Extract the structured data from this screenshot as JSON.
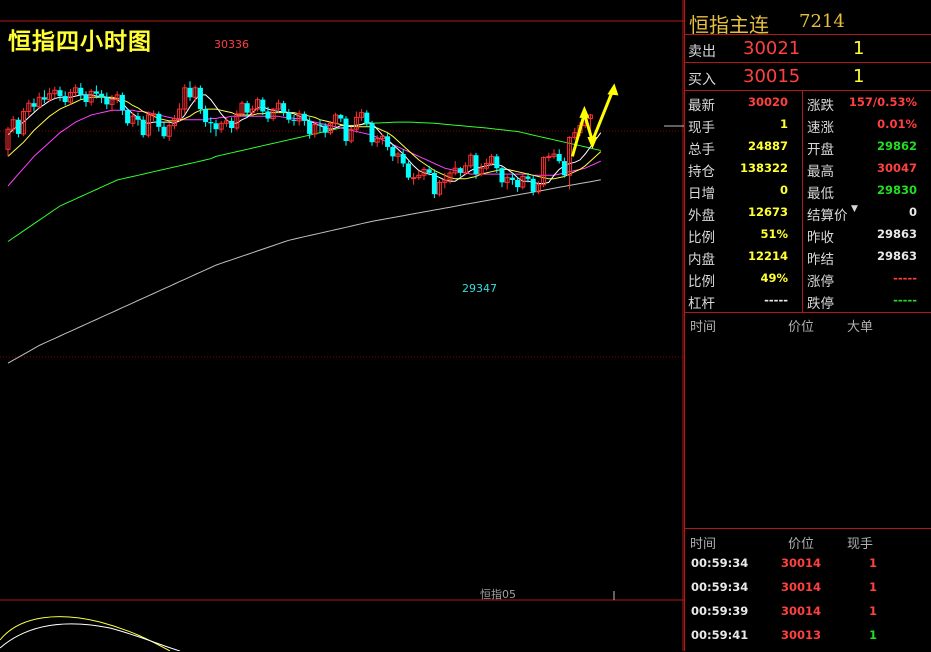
{
  "chart": {
    "title": "恒指四小时图",
    "high_label": "30336",
    "low_label": "29347",
    "contract_label": "恒指05"
  },
  "colors": {
    "up": "#ff3030",
    "down": "#00ffff",
    "ma5": "#ffffff",
    "ma10": "#ffff40",
    "ma20": "#ff40ff",
    "ma60": "#30ff30",
    "ma120": "#c0c0c0",
    "grid": "#8b0000",
    "arrow": "#ffff00"
  },
  "chart_data": {
    "type": "candlestick",
    "ylim": [
      28400,
      30600
    ],
    "candles": [
      [
        29760,
        29930,
        29700,
        29950
      ],
      [
        29930,
        30010,
        29900,
        30040
      ],
      [
        30010,
        29890,
        29860,
        30030
      ],
      [
        29890,
        30080,
        29870,
        30110
      ],
      [
        30080,
        30150,
        30040,
        30180
      ],
      [
        30150,
        30120,
        30080,
        30190
      ],
      [
        30120,
        30200,
        30100,
        30240
      ],
      [
        30200,
        30180,
        30150,
        30260
      ],
      [
        30180,
        30230,
        30160,
        30280
      ],
      [
        30230,
        30260,
        30190,
        30290
      ],
      [
        30260,
        30210,
        30170,
        30290
      ],
      [
        30210,
        30160,
        30130,
        30250
      ],
      [
        30160,
        30240,
        30140,
        30270
      ],
      [
        30240,
        30280,
        30210,
        30310
      ],
      [
        30280,
        30220,
        30180,
        30320
      ],
      [
        30220,
        30160,
        30120,
        30250
      ],
      [
        30160,
        30250,
        30130,
        30270
      ],
      [
        30250,
        30230,
        30190,
        30300
      ],
      [
        30230,
        30200,
        30150,
        30260
      ],
      [
        30200,
        30140,
        30100,
        30240
      ],
      [
        30140,
        30180,
        30080,
        30220
      ],
      [
        30180,
        30220,
        30150,
        30250
      ],
      [
        30220,
        30090,
        30050,
        30240
      ],
      [
        30090,
        29980,
        29960,
        30110
      ],
      [
        29980,
        30040,
        29950,
        30070
      ],
      [
        30040,
        30010,
        29960,
        30070
      ],
      [
        30010,
        29880,
        29860,
        30040
      ],
      [
        29880,
        30050,
        29860,
        30080
      ],
      [
        30050,
        30060,
        30000,
        30090
      ],
      [
        30060,
        29950,
        29910,
        30080
      ],
      [
        29950,
        29870,
        29850,
        29990
      ],
      [
        29870,
        29960,
        29830,
        29980
      ],
      [
        29960,
        30020,
        29930,
        30050
      ],
      [
        30020,
        30100,
        29990,
        30150
      ],
      [
        30100,
        30280,
        30060,
        30310
      ],
      [
        30280,
        30200,
        30170,
        30336
      ],
      [
        30200,
        30280,
        30160,
        30300
      ],
      [
        30280,
        30100,
        30060,
        30300
      ],
      [
        30100,
        29990,
        29950,
        30130
      ],
      [
        29990,
        29980,
        29900,
        30030
      ],
      [
        29980,
        29930,
        29870,
        30010
      ],
      [
        29930,
        29980,
        29900,
        30000
      ],
      [
        29980,
        30000,
        29950,
        30030
      ],
      [
        30000,
        29940,
        29900,
        30030
      ],
      [
        29940,
        30060,
        29920,
        30090
      ],
      [
        30060,
        30150,
        30040,
        30170
      ],
      [
        30150,
        30070,
        30030,
        30170
      ],
      [
        30070,
        30100,
        30050,
        30130
      ],
      [
        30100,
        30180,
        30080,
        30200
      ],
      [
        30180,
        30080,
        30050,
        30200
      ],
      [
        30080,
        30020,
        29990,
        30120
      ],
      [
        30020,
        30100,
        30000,
        30110
      ],
      [
        30100,
        30150,
        30070,
        30180
      ],
      [
        30150,
        30070,
        30040,
        30170
      ],
      [
        30070,
        30010,
        29980,
        30100
      ],
      [
        30010,
        30000,
        29960,
        30050
      ],
      [
        30000,
        30060,
        29960,
        30090
      ],
      [
        30060,
        30000,
        29960,
        30080
      ],
      [
        30000,
        29890,
        29850,
        30030
      ],
      [
        29890,
        29970,
        29860,
        29990
      ],
      [
        29970,
        29960,
        29900,
        30010
      ],
      [
        29960,
        29900,
        29860,
        29980
      ],
      [
        29900,
        29980,
        29880,
        30000
      ],
      [
        29980,
        30050,
        29950,
        30070
      ],
      [
        30050,
        30020,
        29990,
        30060
      ],
      [
        30020,
        29830,
        29790,
        30040
      ],
      [
        29830,
        29930,
        29810,
        29950
      ],
      [
        29930,
        30030,
        29900,
        30080
      ],
      [
        30030,
        30070,
        30000,
        30100
      ],
      [
        30070,
        29980,
        29950,
        30090
      ],
      [
        29980,
        29820,
        29790,
        30000
      ],
      [
        29820,
        29850,
        29780,
        29880
      ],
      [
        29850,
        29870,
        29800,
        29890
      ],
      [
        29870,
        29780,
        29750,
        29900
      ],
      [
        29780,
        29700,
        29660,
        29800
      ],
      [
        29700,
        29720,
        29640,
        29740
      ],
      [
        29720,
        29640,
        29610,
        29760
      ],
      [
        29640,
        29520,
        29500,
        29660
      ],
      [
        29520,
        29520,
        29460,
        29560
      ],
      [
        29520,
        29540,
        29500,
        29580
      ],
      [
        29540,
        29590,
        29500,
        29610
      ],
      [
        29590,
        29560,
        29540,
        29620
      ],
      [
        29560,
        29380,
        29347,
        29590
      ],
      [
        29380,
        29480,
        29360,
        29500
      ],
      [
        29480,
        29500,
        29430,
        29560
      ],
      [
        29500,
        29560,
        29470,
        29580
      ],
      [
        29560,
        29600,
        29540,
        29660
      ],
      [
        29600,
        29560,
        29530,
        29610
      ],
      [
        29560,
        29620,
        29540,
        29650
      ],
      [
        29620,
        29710,
        29600,
        29730
      ],
      [
        29710,
        29550,
        29510,
        29730
      ],
      [
        29550,
        29600,
        29530,
        29640
      ],
      [
        29600,
        29640,
        29580,
        29680
      ],
      [
        29640,
        29700,
        29620,
        29720
      ],
      [
        29700,
        29600,
        29560,
        29720
      ],
      [
        29600,
        29480,
        29440,
        29620
      ],
      [
        29480,
        29520,
        29420,
        29540
      ],
      [
        29520,
        29500,
        29460,
        29560
      ],
      [
        29500,
        29440,
        29400,
        29520
      ],
      [
        29440,
        29530,
        29420,
        29560
      ],
      [
        29530,
        29510,
        29480,
        29560
      ],
      [
        29510,
        29400,
        29370,
        29540
      ],
      [
        29400,
        29460,
        29380,
        29490
      ],
      [
        29460,
        29690,
        29440,
        29700
      ],
      [
        29690,
        29700,
        29660,
        29730
      ],
      [
        29700,
        29720,
        29680,
        29760
      ],
      [
        29720,
        29660,
        29640,
        29760
      ],
      [
        29660,
        29540,
        29520,
        29690
      ],
      [
        29540,
        29860,
        29420,
        29870
      ],
      [
        29860,
        29900,
        29840,
        29940
      ],
      [
        29900,
        29960,
        29870,
        29990
      ],
      [
        29960,
        30020,
        29940,
        30030
      ],
      [
        30020,
        30050,
        29870,
        30060
      ]
    ],
    "ma5": [
      29880,
      29930,
      29960,
      29990,
      30030,
      30070,
      30110,
      30140,
      30170,
      30190,
      30200,
      30200,
      30200,
      30210,
      30220,
      30220,
      30220,
      30210,
      30210,
      30200,
      30190,
      30180,
      30150,
      30100,
      30060,
      30030,
      29990,
      29980,
      29990,
      29990,
      29990,
      29990,
      29980,
      30000,
      30050,
      30120,
      30180,
      30220,
      30220,
      30180,
      30120,
      30060,
      30010,
      29980,
      29980,
      30010,
      30030,
      30070,
      30110,
      30120,
      30100,
      30090,
      30080,
      30080,
      30070,
      30060,
      30040,
      30020,
      30000,
      29980,
      29960,
      29940,
      29930,
      29940,
      29960,
      29960,
      29950,
      29960,
      29970,
      29990,
      29980,
      29930,
      29880,
      29840,
      29800,
      29760,
      29720,
      29670,
      29620,
      29580,
      29560,
      29550,
      29540,
      29520,
      29500,
      29490,
      29490,
      29520,
      29550,
      29580,
      29600,
      29610,
      29620,
      29630,
      29630,
      29620,
      29590,
      29560,
      29520,
      29490,
      29490,
      29480,
      29470,
      29470,
      29480,
      29540,
      29590,
      29620,
      29640,
      29650,
      29670,
      29720,
      29780,
      29840,
      29900
    ],
    "ma10": [
      29700,
      29740,
      29780,
      29820,
      29870,
      29920,
      29960,
      30000,
      30040,
      30070,
      30100,
      30120,
      30140,
      30160,
      30180,
      30190,
      30200,
      30200,
      30200,
      30200,
      30200,
      30190,
      30180,
      30160,
      30130,
      30110,
      30080,
      30060,
      30040,
      30020,
      30010,
      30000,
      30000,
      30000,
      30020,
      30040,
      30070,
      30090,
      30100,
      30100,
      30100,
      30090,
      30080,
      30070,
      30050,
      30050,
      30050,
      30050,
      30060,
      30060,
      30070,
      30070,
      30070,
      30070,
      30070,
      30070,
      30060,
      30050,
      30040,
      30030,
      30010,
      30000,
      29990,
      29980,
      29970,
      29960,
      29960,
      29950,
      29950,
      29950,
      29950,
      29940,
      29920,
      29900,
      29870,
      29830,
      29790,
      29750,
      29710,
      29670,
      29640,
      29610,
      29580,
      29560,
      29540,
      29520,
      29510,
      29510,
      29510,
      29520,
      29530,
      29550,
      29560,
      29570,
      29580,
      29590,
      29590,
      29580,
      29570,
      29560,
      29550,
      29540,
      29530,
      29520,
      29510,
      29510,
      29520,
      29530,
      29550,
      29570,
      29590,
      29620,
      29660,
      29700,
      29740
    ],
    "ma20": [
      29450,
      29500,
      29550,
      29600,
      29650,
      29700,
      29740,
      29780,
      29820,
      29860,
      29900,
      29930,
      29960,
      29990,
      30010,
      30030,
      30050,
      30060,
      30070,
      30080,
      30090,
      30090,
      30090,
      30090,
      30090,
      30080,
      30080,
      30070,
      30060,
      30050,
      30040,
      30030,
      30020,
      30010,
      30010,
      30010,
      30010,
      30010,
      30010,
      30020,
      30020,
      30030,
      30030,
      30040,
      30040,
      30040,
      30040,
      30040,
      30040,
      30040,
      30040,
      30040,
      30040,
      30030,
      30030,
      30020,
      30020,
      30010,
      30000,
      29990,
      29980,
      29970,
      29960,
      29950,
      29940,
      29930,
      29920,
      29910,
      29900,
      29890,
      29880,
      29860,
      29840,
      29820,
      29800,
      29780,
      29760,
      29740,
      29720,
      29700,
      29680,
      29660,
      29640,
      29620,
      29600,
      29590,
      29580,
      29570,
      29560,
      29550,
      29550,
      29550,
      29550,
      29550,
      29550,
      29550,
      29550,
      29550,
      29550,
      29550,
      29550,
      29540,
      29540,
      29540,
      29540,
      29540,
      29550,
      29560,
      29570,
      29580,
      29590,
      29600,
      29620,
      29640,
      29660
    ],
    "ma60": [
      28980,
      29010,
      29040,
      29070,
      29100,
      29130,
      29160,
      29190,
      29220,
      29250,
      29280,
      29300,
      29320,
      29340,
      29360,
      29380,
      29400,
      29420,
      29440,
      29460,
      29480,
      29500,
      29510,
      29520,
      29530,
      29540,
      29550,
      29560,
      29570,
      29580,
      29590,
      29600,
      29610,
      29620,
      29630,
      29640,
      29650,
      29660,
      29670,
      29680,
      29700,
      29710,
      29720,
      29730,
      29740,
      29750,
      29760,
      29770,
      29780,
      29790,
      29800,
      29810,
      29820,
      29830,
      29840,
      29850,
      29860,
      29870,
      29880,
      29890,
      29900,
      29910,
      29920,
      29930,
      29940,
      29950,
      29960,
      29965,
      29970,
      29975,
      29980,
      29982,
      29984,
      29986,
      29988,
      29990,
      29990,
      29990,
      29988,
      29986,
      29984,
      29982,
      29980,
      29976,
      29972,
      29968,
      29964,
      29960,
      29956,
      29952,
      29948,
      29944,
      29940,
      29935,
      29930,
      29925,
      29920,
      29915,
      29910,
      29900,
      29890,
      29880,
      29870,
      29860,
      29850,
      29840,
      29830,
      29820,
      29810,
      29800,
      29790,
      29780,
      29770,
      29760,
      29750
    ],
    "ma120": [
      27950,
      27975,
      28000,
      28025,
      28050,
      28075,
      28100,
      28120,
      28140,
      28160,
      28180,
      28200,
      28220,
      28240,
      28260,
      28280,
      28300,
      28320,
      28340,
      28360,
      28380,
      28400,
      28420,
      28440,
      28460,
      28480,
      28500,
      28520,
      28540,
      28560,
      28580,
      28600,
      28620,
      28640,
      28660,
      28680,
      28700,
      28720,
      28740,
      28760,
      28780,
      28795,
      28810,
      28825,
      28840,
      28855,
      28870,
      28885,
      28900,
      28915,
      28930,
      28945,
      28960,
      28975,
      28990,
      29000,
      29010,
      29020,
      29030,
      29040,
      29050,
      29060,
      29070,
      29080,
      29090,
      29100,
      29110,
      29120,
      29130,
      29140,
      29150,
      29158,
      29166,
      29174,
      29182,
      29190,
      29198,
      29206,
      29214,
      29222,
      29230,
      29238,
      29246,
      29254,
      29262,
      29270,
      29278,
      29286,
      29294,
      29302,
      29310,
      29318,
      29326,
      29334,
      29342,
      29350,
      29358,
      29366,
      29374,
      29382,
      29390,
      29398,
      29406,
      29414,
      29422,
      29430,
      29438,
      29446,
      29454,
      29462,
      29470,
      29478,
      29486,
      29494,
      29502
    ]
  },
  "sidebar": {
    "name": "恒指主连",
    "code": "7214",
    "sell_label": "卖出",
    "sell_price": "30021",
    "sell_vol": "1",
    "buy_label": "买入",
    "buy_price": "30015",
    "buy_vol": "1",
    "quotes": [
      {
        "lk": "最新",
        "lv": "30020",
        "lc": "red",
        "rk": "涨跌",
        "rv": "157/0.53%",
        "rc": "red"
      },
      {
        "lk": "现手",
        "lv": "1",
        "lc": "yel",
        "rk": "速涨",
        "rv": "0.01%",
        "rc": "red"
      },
      {
        "lk": "总手",
        "lv": "24887",
        "lc": "yel",
        "rk": "开盘",
        "rv": "29862",
        "rc": "grn"
      },
      {
        "lk": "持仓",
        "lv": "138322",
        "lc": "yel",
        "rk": "最高",
        "rv": "30047",
        "rc": "red"
      },
      {
        "lk": "日增",
        "lv": "0",
        "lc": "yel",
        "rk": "最低",
        "rv": "29830",
        "rc": "grn"
      },
      {
        "lk": "外盘",
        "lv": "12673",
        "lc": "yel",
        "rk": "结算价",
        "rv": "0",
        "rc": "wht"
      },
      {
        "lk": "比例",
        "lv": "51%",
        "lc": "yel",
        "rk": "昨收",
        "rv": "29863",
        "rc": "wht"
      },
      {
        "lk": "内盘",
        "lv": "12214",
        "lc": "yel",
        "rk": "昨结",
        "rv": "29863",
        "rc": "wht"
      },
      {
        "lk": "比例",
        "lv": "49%",
        "lc": "yel",
        "rk": "涨停",
        "rv": "-----",
        "rc": "red"
      },
      {
        "lk": "杠杆",
        "lv": "-----",
        "lc": "wht",
        "rk": "跌停",
        "rv": "-----",
        "rc": "grn"
      }
    ],
    "big_order_headers": {
      "time": "时间",
      "price": "价位",
      "big": "大单"
    },
    "tick_headers": {
      "time": "时间",
      "price": "价位",
      "vol": "现手"
    },
    "ticks": [
      {
        "time": "00:59:34",
        "price": "30014",
        "vol": "1",
        "vc": "red"
      },
      {
        "time": "00:59:34",
        "price": "30014",
        "vol": "1",
        "vc": "red"
      },
      {
        "time": "00:59:39",
        "price": "30014",
        "vol": "1",
        "vc": "red"
      },
      {
        "time": "00:59:41",
        "price": "30013",
        "vol": "1",
        "vc": "grn"
      }
    ]
  }
}
